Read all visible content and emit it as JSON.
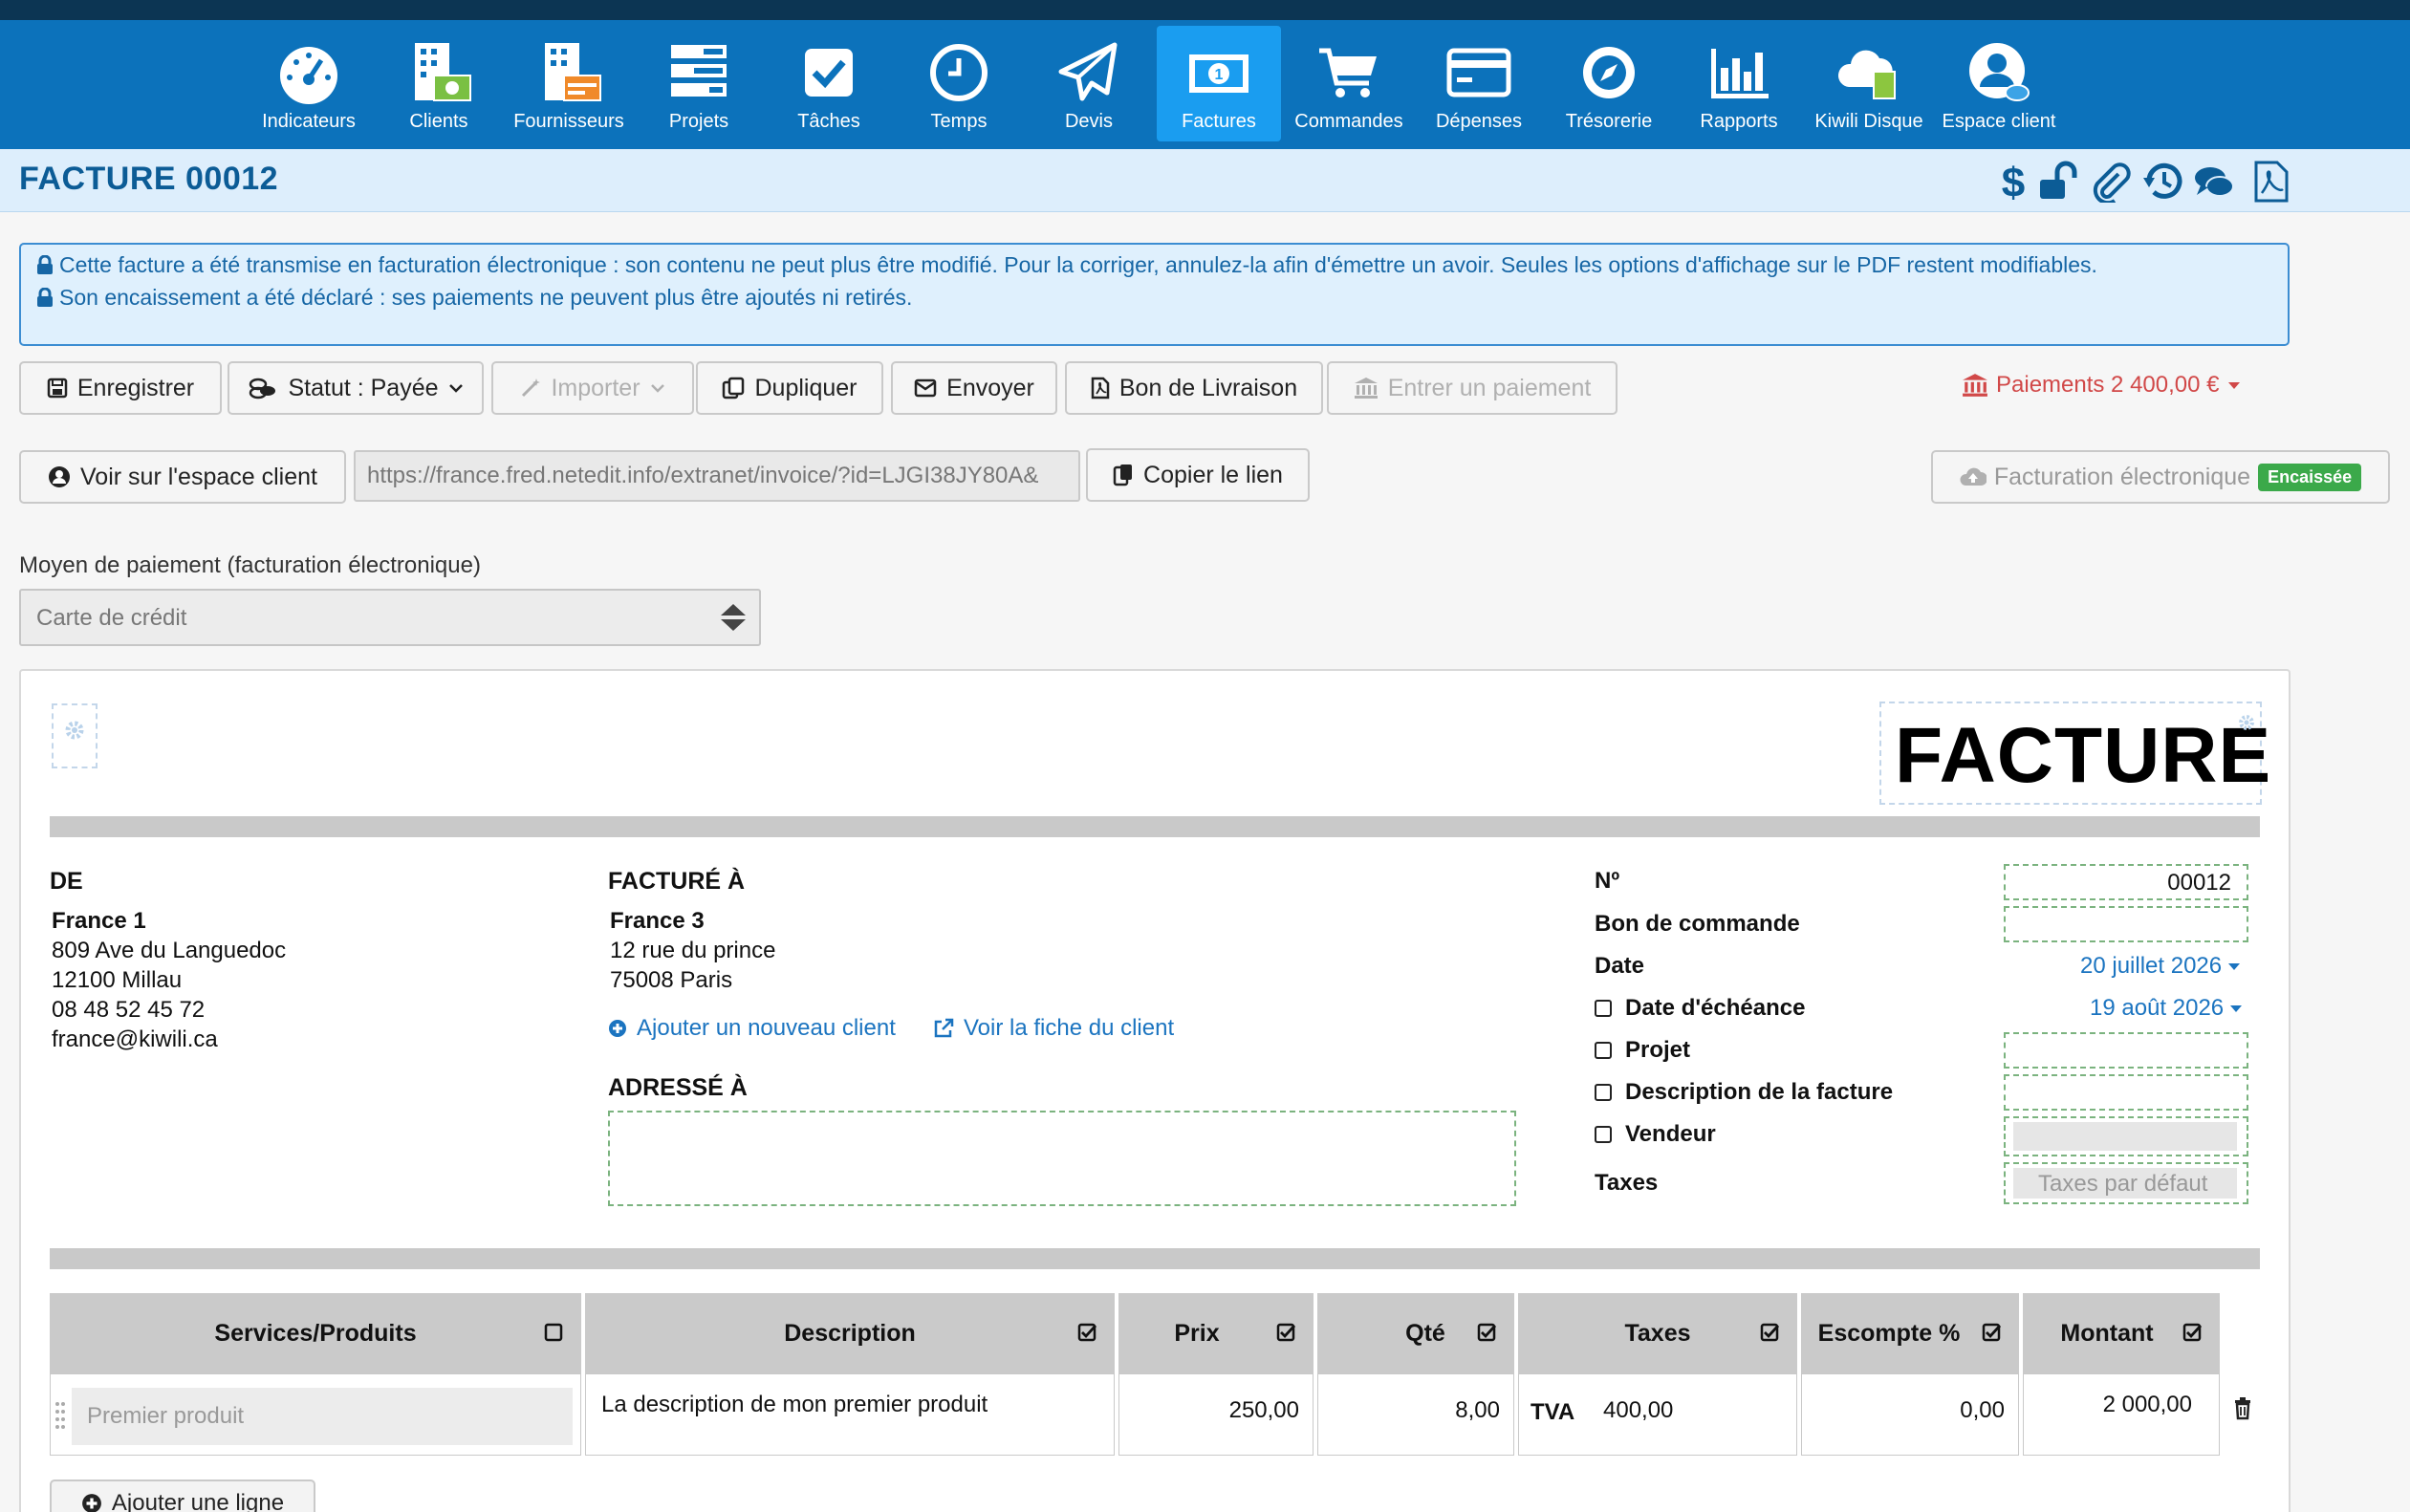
{
  "nav": {
    "items": [
      {
        "label": "Indicateurs",
        "icon": "gauge-icon"
      },
      {
        "label": "Clients",
        "icon": "building-money-icon"
      },
      {
        "label": "Fournisseurs",
        "icon": "building-card-icon"
      },
      {
        "label": "Projets",
        "icon": "stacked-bars-icon"
      },
      {
        "label": "Tâches",
        "icon": "checkbox-icon"
      },
      {
        "label": "Temps",
        "icon": "clock-icon"
      },
      {
        "label": "Devis",
        "icon": "paper-plane-icon"
      },
      {
        "label": "Factures",
        "icon": "banknote-icon"
      },
      {
        "label": "Commandes",
        "icon": "cart-icon"
      },
      {
        "label": "Dépenses",
        "icon": "credit-card-icon"
      },
      {
        "label": "Trésorerie",
        "icon": "compass-icon"
      },
      {
        "label": "Rapports",
        "icon": "bar-chart-icon"
      },
      {
        "label": "Kiwili Disque",
        "icon": "cloud-file-icon"
      },
      {
        "label": "Espace client",
        "icon": "user-chat-icon"
      }
    ],
    "active": "Factures"
  },
  "header": {
    "title": "FACTURE 00012",
    "actions": [
      "dollar-icon",
      "unlock-icon",
      "paperclip-icon",
      "history-icon",
      "comments-icon",
      "pdf-icon"
    ]
  },
  "banner": {
    "line1": "Cette facture a été transmise en facturation électronique : son contenu ne peut plus être modifié. Pour la corriger, annulez-la afin d'émettre un avoir. Seules les options d'affichage sur le PDF restent modifiables.",
    "line2": "Son encaissement a été déclaré : ses paiements ne peuvent plus être ajoutés ni retirés."
  },
  "toolbar": {
    "save": "Enregistrer",
    "status": "Statut : Payée",
    "import": "Importer",
    "duplicate": "Dupliquer",
    "send": "Envoyer",
    "delivery": "Bon de Livraison",
    "payment": "Entrer un paiement",
    "payments": "Paiements 2 400,00 €"
  },
  "client_link": {
    "view": "Voir sur l'espace client",
    "url": "https://france.fred.netedit.info/extranet/invoice/?id=LJGI38JY80A&",
    "copy": "Copier le lien",
    "einvoice": "Facturation électronique",
    "einvoice_badge": "Encaissée"
  },
  "payment_method": {
    "label": "Moyen de paiement (facturation électronique)",
    "value": "Carte de crédit"
  },
  "invoice": {
    "doc_title": "FACTURE",
    "from": {
      "heading": "DE",
      "name": "France 1",
      "street": "809 Ave du Languedoc",
      "city": "12100 Millau",
      "phone": "08 48 52 45 72",
      "email": "france@kiwili.ca"
    },
    "billed_to": {
      "heading": "FACTURÉ À",
      "name": "France 3",
      "street": "12 rue du prince",
      "city": "75008 Paris",
      "add_client": "Ajouter un nouveau client",
      "view_client": "Voir la fiche du client"
    },
    "addressed_to": {
      "heading": "ADRESSÉ À"
    },
    "meta": {
      "number_label": "Nº",
      "number": "00012",
      "order_label": "Bon de commande",
      "date_label": "Date",
      "date": "20 juillet 2026",
      "due_label": "Date d'échéance",
      "due": "19 août 2026",
      "project_label": "Projet",
      "desc_label": "Description de la facture",
      "seller_label": "Vendeur",
      "taxes_label": "Taxes",
      "taxes_value": "Taxes par défaut"
    },
    "table": {
      "headers": [
        "Services/Produits",
        "Description",
        "Prix",
        "Qté",
        "Taxes",
        "Escompte %",
        "Montant"
      ],
      "rows": [
        {
          "product": "Premier produit",
          "description": "La description de mon premier produit",
          "price": "250,00",
          "qty": "8,00",
          "tax_name": "TVA",
          "tax_amount": "400,00",
          "discount": "0,00",
          "amount": "2 000,00"
        }
      ]
    },
    "add_line": "Ajouter une ligne"
  }
}
